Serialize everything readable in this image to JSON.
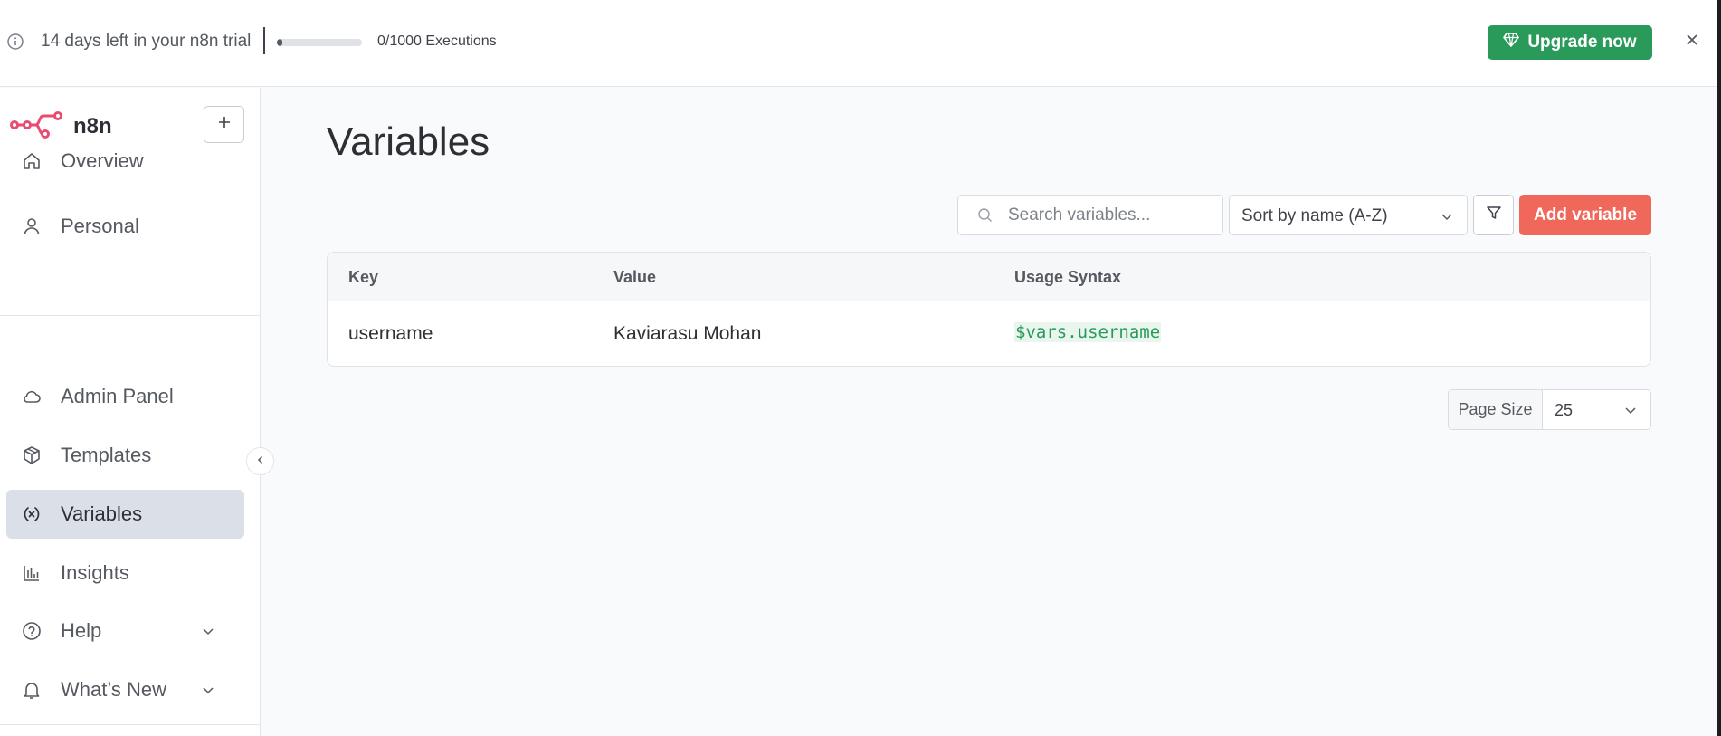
{
  "banner": {
    "trial_text": "14 days left in your n8n trial",
    "executions_text": "0/1000 Executions",
    "executions_progress": 0.0,
    "upgrade_label": "Upgrade now",
    "upgrade_color": "#2a9a5b"
  },
  "sidebar": {
    "logo_text": "n8n",
    "brand_color": "#ea4b71",
    "items": [
      {
        "label": "Overview",
        "icon": "home-icon"
      },
      {
        "label": "Personal",
        "icon": "user-icon"
      },
      {
        "label": "Admin Panel",
        "icon": "cloud-icon"
      },
      {
        "label": "Templates",
        "icon": "box-icon"
      },
      {
        "label": "Variables",
        "icon": "variable-icon",
        "active": true
      },
      {
        "label": "Insights",
        "icon": "bar-chart-icon"
      },
      {
        "label": "Help",
        "icon": "help-circle-icon"
      },
      {
        "label": "What’s New",
        "icon": "bell-icon"
      }
    ]
  },
  "main": {
    "title": "Variables",
    "search_placeholder": "Search variables...",
    "sort_label": "Sort by name (A-Z)",
    "add_label": "Add variable",
    "add_color": "#f0685a",
    "table": {
      "headers": [
        "Key",
        "Value",
        "Usage Syntax"
      ],
      "rows": [
        {
          "key": "username",
          "value": "Kaviarasu Mohan",
          "usage": "$vars.username"
        }
      ]
    },
    "page_size_label": "Page Size",
    "page_size_value": "25"
  }
}
